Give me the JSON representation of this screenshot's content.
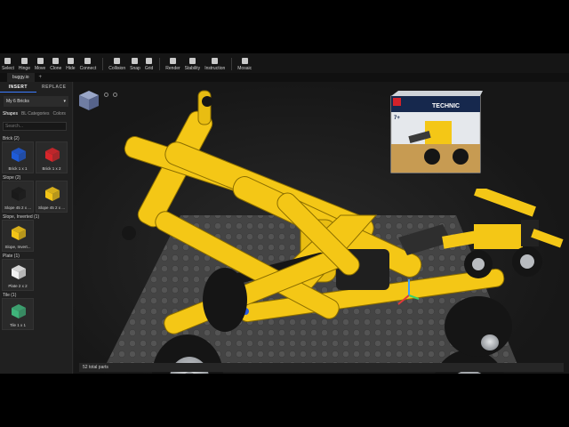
{
  "toolbar": {
    "groups": [
      [
        {
          "label": "Select",
          "icon": "select-icon"
        },
        {
          "label": "Hinge",
          "icon": "hinge-icon"
        },
        {
          "label": "Move",
          "icon": "move-icon"
        },
        {
          "label": "Clone",
          "icon": "clone-icon"
        },
        {
          "label": "Hide",
          "icon": "hide-icon"
        },
        {
          "label": "Connect",
          "icon": "connect-icon"
        }
      ],
      [
        {
          "label": "Collision",
          "icon": "collision-icon"
        },
        {
          "label": "Snap",
          "icon": "snap-icon"
        },
        {
          "label": "Grid",
          "icon": "grid-icon"
        }
      ],
      [
        {
          "label": "Render",
          "icon": "render-icon"
        },
        {
          "label": "Stability",
          "icon": "stability-icon"
        },
        {
          "label": "Instruction",
          "icon": "instruction-icon"
        }
      ],
      [
        {
          "label": "Mosaic",
          "icon": "mosaic-icon"
        }
      ]
    ]
  },
  "file_tab": {
    "name": "buggy.io",
    "new_tab": "+"
  },
  "sidebar": {
    "mode_tabs": [
      "INSERT",
      "REPLACE"
    ],
    "set_selector": {
      "value": "My 6 Bricks",
      "arrow": "▾"
    },
    "sub_tabs": [
      "Shapes",
      "BL Categories",
      "Colors"
    ],
    "search_placeholder": "Search...",
    "categories": [
      {
        "title": "Brick (2)",
        "parts": [
          {
            "label": "Brick 1 x 1",
            "color": "#1e5bd8"
          },
          {
            "label": "Brick 1 x 2",
            "color": "#d8262b"
          }
        ]
      },
      {
        "title": "Slope (2)",
        "parts": [
          {
            "label": "Slope 45 2 x ...",
            "color": "#1a1a1a"
          },
          {
            "label": "Slope 45 2 x ...",
            "color": "#f3c417"
          }
        ]
      },
      {
        "title": "Slope, Inverted (1)",
        "parts": [
          {
            "label": "Slope, Invert...",
            "color": "#f3c417"
          }
        ]
      },
      {
        "title": "Plate (1)",
        "parts": [
          {
            "label": "Plate 2 x 2",
            "color": "#f2f2f2"
          }
        ]
      },
      {
        "title": "Tile (1)",
        "parts": [
          {
            "label": "Tile 1 x 1",
            "color": "#3fb37a"
          }
        ]
      }
    ]
  },
  "viewport": {
    "status": "52 total parts",
    "box_art": {
      "brand": "TECHNIC",
      "age": "7+"
    }
  },
  "colors": {
    "accent": "#3c7cff",
    "technic_yellow": "#f4c716",
    "tire": "#151515",
    "hub": "#b9bcc0",
    "baseplate": "#4a4a4a"
  }
}
